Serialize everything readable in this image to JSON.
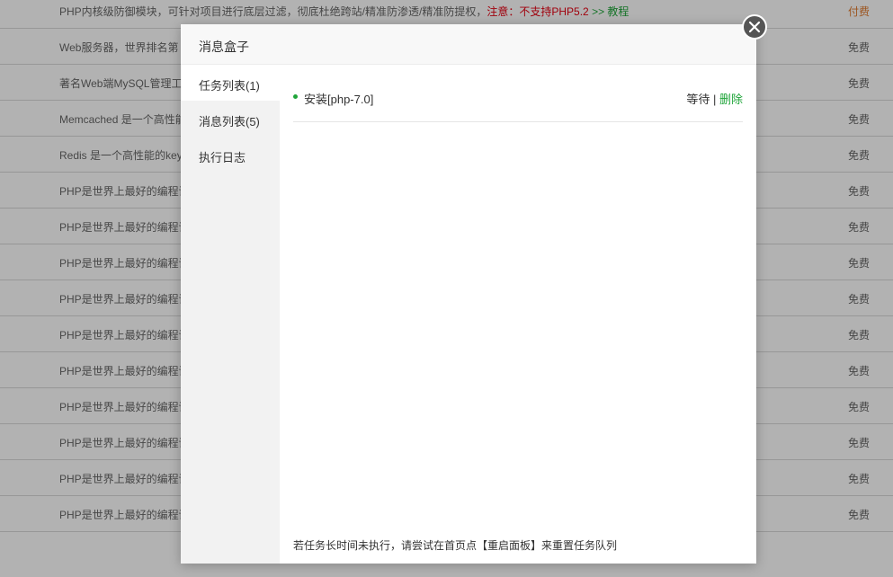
{
  "background_list": {
    "rows": [
      {
        "desc_prefix": "PHP内核级防御模块，可针对项目进行底层过滤，彻底杜绝跨站/精准防渗透/精准防提权，",
        "desc_warning": "注意：不支持PHP5.2",
        "desc_link": ">> 教程",
        "price": "付费"
      },
      {
        "desc_prefix": "Web服务器，世界排名第",
        "price": "免费"
      },
      {
        "desc_prefix": "著名Web端MySQL管理工",
        "price": "免费"
      },
      {
        "desc_prefix": "Memcached 是一个高性能",
        "price": "免费"
      },
      {
        "desc_prefix": "Redis 是一个高性能的key",
        "price": "免费"
      },
      {
        "desc_prefix": "PHP是世界上最好的编程语",
        "price": "免费"
      },
      {
        "desc_prefix": "PHP是世界上最好的编程语",
        "price": "免费"
      },
      {
        "desc_prefix": "PHP是世界上最好的编程语",
        "price": "免费"
      },
      {
        "desc_prefix": "PHP是世界上最好的编程语",
        "price": "免费"
      },
      {
        "desc_prefix": "PHP是世界上最好的编程语",
        "price": "免费"
      },
      {
        "desc_prefix": "PHP是世界上最好的编程语",
        "price": "免费"
      },
      {
        "desc_prefix": "PHP是世界上最好的编程语",
        "price": "免费"
      },
      {
        "desc_prefix": "PHP是世界上最好的编程语",
        "price": "免费"
      },
      {
        "desc_prefix": "PHP是世界上最好的编程语",
        "price": "免费"
      },
      {
        "desc_prefix": "PHP是世界上最好的编程语",
        "price": "免费"
      }
    ]
  },
  "dialog": {
    "title": "消息盒子",
    "tabs": [
      {
        "label": "任务列表(1)"
      },
      {
        "label": "消息列表(5)"
      },
      {
        "label": "执行日志"
      }
    ],
    "task": {
      "name": "安装[php-7.0]",
      "status": "等待",
      "separator": " | ",
      "delete_label": "删除"
    },
    "footer_note": "若任务长时间未执行，请尝试在首页点【重启面板】来重置任务队列"
  },
  "colors": {
    "accent_green": "#20a53a",
    "warning_red": "#e60012",
    "paid_orange": "#e07a2f"
  }
}
